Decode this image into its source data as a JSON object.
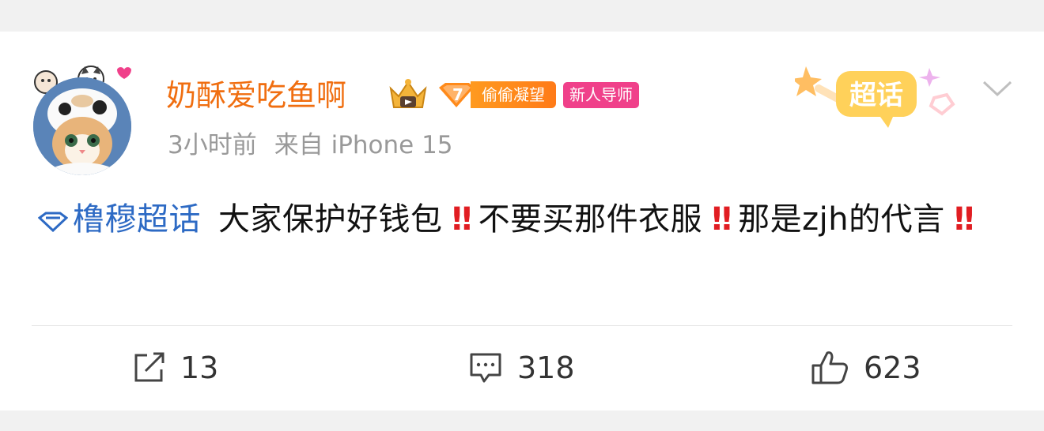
{
  "background_band_color": "#f1f1f1",
  "post": {
    "username": "奶酥爱吃鱼啊",
    "username_color": "#f06e10",
    "level_badge": {
      "level": "7",
      "label": "偷偷凝望"
    },
    "mentor_badge": "新人导师",
    "time": "3小时前",
    "source": "来自 iPhone 15",
    "super_topic_label": "超话",
    "topic": "橹穆超话",
    "text_segments": [
      "大家保护好钱包",
      "‼",
      "不要买那件衣服",
      "‼",
      "那是zjh的代言",
      "‼"
    ],
    "accent_link_color": "#2d6ac4",
    "alert_color": "#e11d22"
  },
  "actions": {
    "repost_count": "13",
    "comment_count": "318",
    "like_count": "623"
  },
  "icons": {
    "avatar": "cat-with-cow-hat-avatar",
    "crown": "crown-icon",
    "super_topic": "super-topic-badge",
    "menu": "chevron-down-icon",
    "topic": "diamond-topic-icon",
    "repost": "repost-icon",
    "comment": "comment-icon",
    "like": "thumbs-up-icon"
  }
}
